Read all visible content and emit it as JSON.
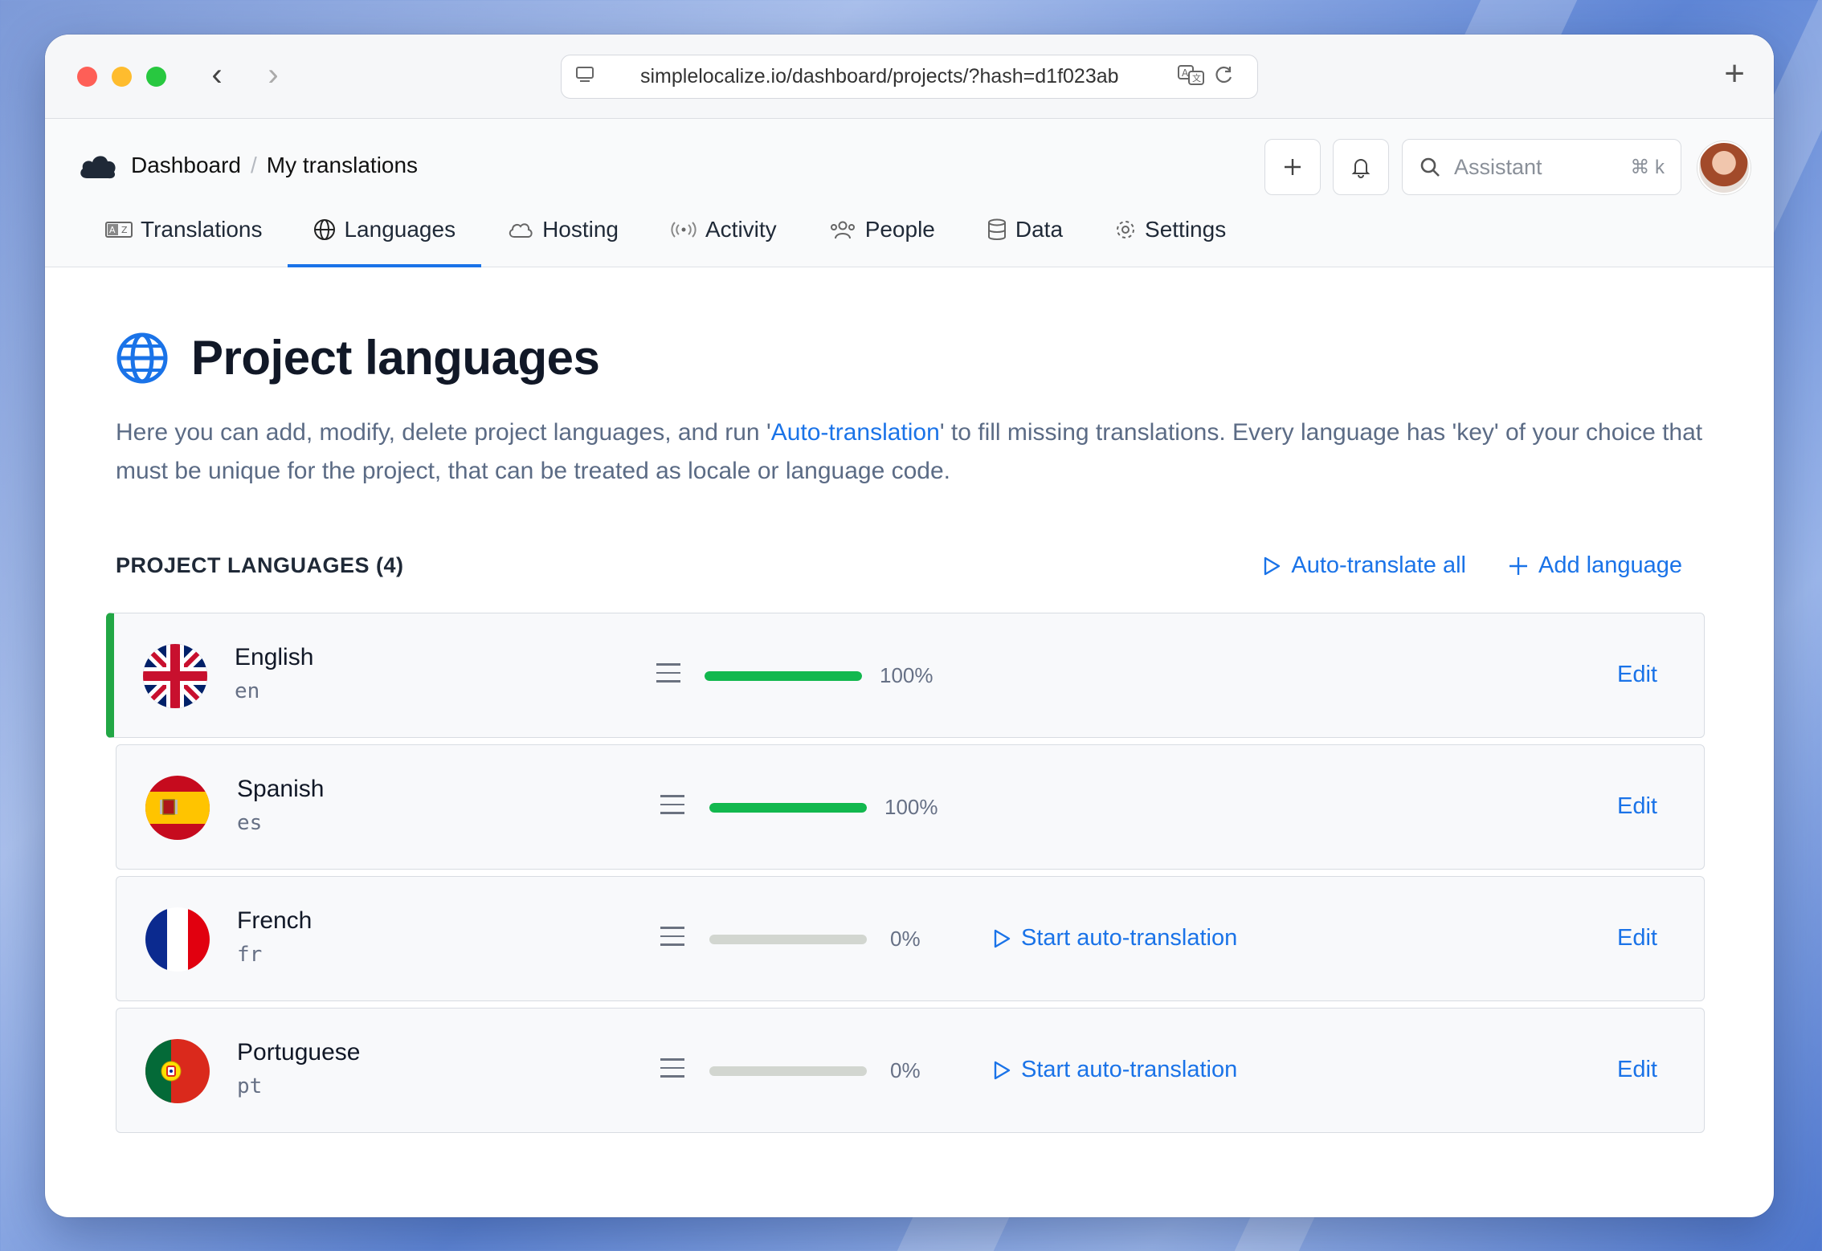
{
  "browser": {
    "url": "simplelocalize.io/dashboard/projects/?hash=d1f023ab",
    "new_tab": "+"
  },
  "header": {
    "breadcrumb": {
      "root": "Dashboard",
      "current": "My translations"
    },
    "search_placeholder": "Assistant",
    "search_shortcut": "⌘ k",
    "tabs": [
      {
        "label": "Translations",
        "icon": "translations-icon"
      },
      {
        "label": "Languages",
        "icon": "globe-icon",
        "active": true
      },
      {
        "label": "Hosting",
        "icon": "cloud-icon"
      },
      {
        "label": "Activity",
        "icon": "broadcast-icon"
      },
      {
        "label": "People",
        "icon": "people-icon"
      },
      {
        "label": "Data",
        "icon": "database-icon"
      },
      {
        "label": "Settings",
        "icon": "gear-icon"
      }
    ]
  },
  "main": {
    "title": "Project languages",
    "description_pre": "Here you can add, modify, delete project languages, and run '",
    "description_link": "Auto-translation",
    "description_post": "' to fill missing translations. Every language has 'key' of your choice that must be unique for the project, that can be treated as locale or language code.",
    "section_title": "PROJECT LANGUAGES (4)",
    "auto_translate_all": "Auto-translate all",
    "add_language": "Add language",
    "edit_label": "Edit",
    "start_auto_label": "Start auto-translation",
    "languages": [
      {
        "name": "English",
        "key": "en",
        "progress": 100,
        "progress_label": "100%",
        "flag": "uk-flag",
        "default": true
      },
      {
        "name": "Spanish",
        "key": "es",
        "progress": 100,
        "progress_label": "100%",
        "flag": "spain-flag"
      },
      {
        "name": "French",
        "key": "fr",
        "progress": 0,
        "progress_label": "0%",
        "flag": "france-flag"
      },
      {
        "name": "Portuguese",
        "key": "pt",
        "progress": 0,
        "progress_label": "0%",
        "flag": "portugal-flag"
      }
    ]
  },
  "colors": {
    "accent": "#1a73e8",
    "success": "#12b84e",
    "default_marker": "#22a745"
  }
}
